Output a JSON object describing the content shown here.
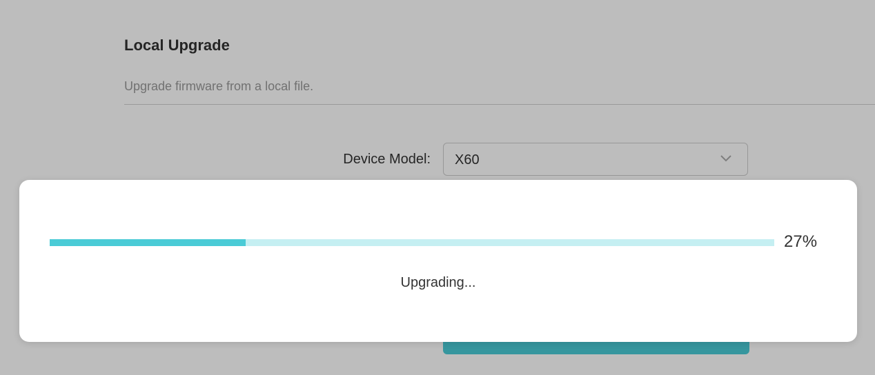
{
  "local_upgrade": {
    "title": "Local Upgrade",
    "description": "Upgrade firmware from a local file."
  },
  "device_model": {
    "label": "Device Model:",
    "selected": "X60",
    "icon": "chevron-down-icon"
  },
  "upgrade_dialog": {
    "progress_percent_text": "27%",
    "progress_fraction": 0.27,
    "status": "Upgrading..."
  },
  "colors": {
    "accent": "#4acbd6",
    "track": "#c5eff2"
  }
}
